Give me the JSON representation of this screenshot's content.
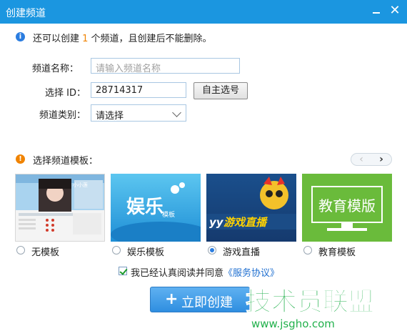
{
  "window": {
    "title": "创建频道"
  },
  "info": {
    "prefix": "还可以创建 ",
    "count": "1",
    "suffix": " 个频道，且创建后不能删除。"
  },
  "form": {
    "name_label": "频道名称：",
    "name_placeholder": "请输入频道名称",
    "id_label": "选择 ID：",
    "id_value": "28714317",
    "self_select_button": "自主选号",
    "category_label": "频道类别：",
    "category_value": "请选择"
  },
  "templates": {
    "section_label": "选择频道模板：",
    "items": [
      {
        "label": "无模板",
        "selected": false,
        "thumb_text": "小小莲"
      },
      {
        "label": "娱乐模板",
        "selected": false,
        "thumb_text": "娱乐",
        "thumb_sub": "模板"
      },
      {
        "label": "游戏直播",
        "selected": true,
        "thumb_text": "游戏直播",
        "thumb_sub": "yy"
      },
      {
        "label": "教育模板",
        "selected": false,
        "thumb_text": "教育模版"
      }
    ]
  },
  "agreement": {
    "text": "我已经认真阅读并同意",
    "link": "《服务协议》",
    "checked": true
  },
  "create_button": "立即创建",
  "watermark": {
    "text": "技术员联盟",
    "url": "www.jsgho.com"
  },
  "colors": {
    "titlebar": "#1b96e0",
    "accent": "#2b7de0",
    "count": "#f08300",
    "link": "#1f6fd0",
    "watermark": "#22b14c"
  }
}
